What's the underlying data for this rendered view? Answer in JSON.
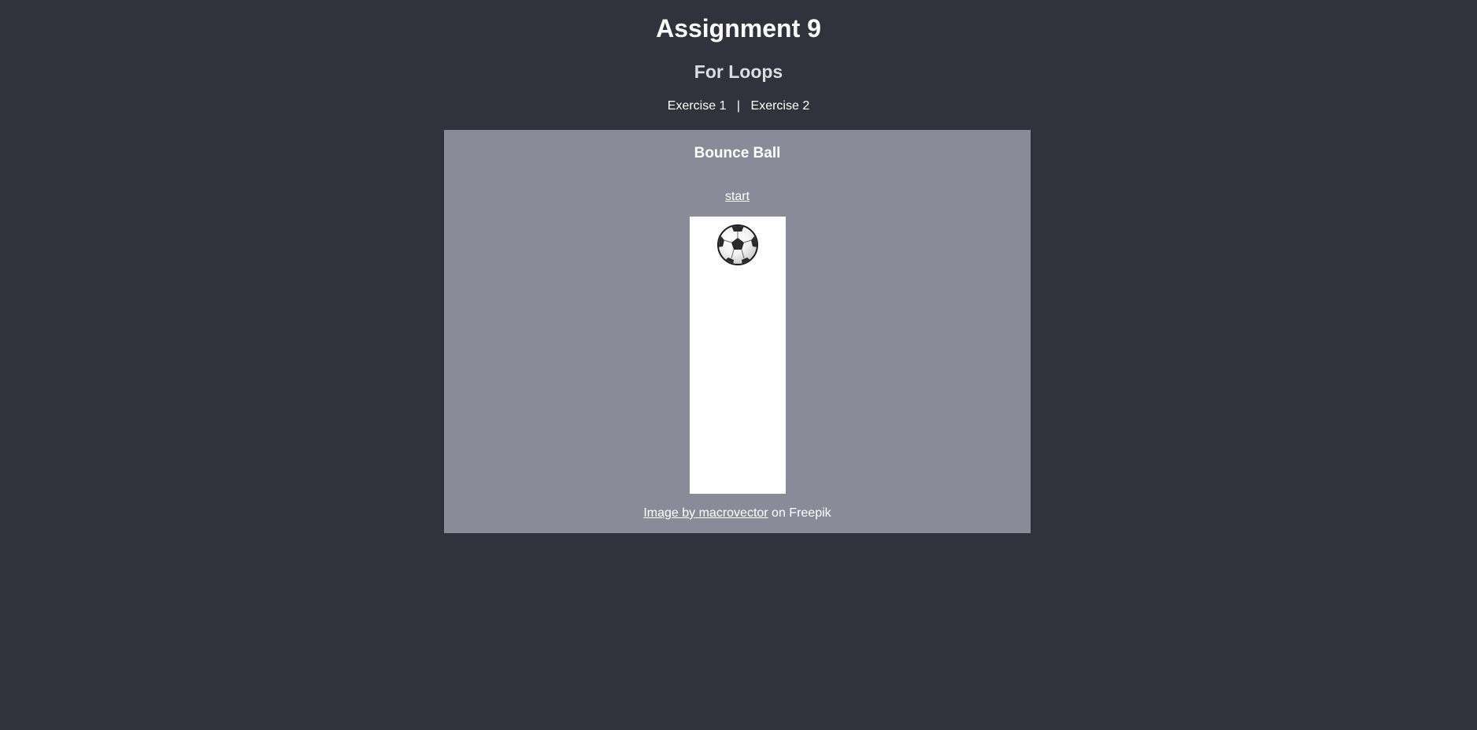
{
  "header": {
    "title": "Assignment 9",
    "subtitle": "For Loops"
  },
  "nav": {
    "links": [
      "Exercise 1",
      "Exercise 2"
    ],
    "separator": "|"
  },
  "panel": {
    "title": "Bounce Ball",
    "start_label": "start",
    "ball_icon": "soccer-ball-icon",
    "credit": {
      "link_text": "Image by macrovector",
      "suffix_text": " on Freepik"
    }
  },
  "colors": {
    "page_background": "#32323c",
    "panel_background": "#8b8a98",
    "track_background": "#ffffff",
    "text": "#ffffff"
  }
}
